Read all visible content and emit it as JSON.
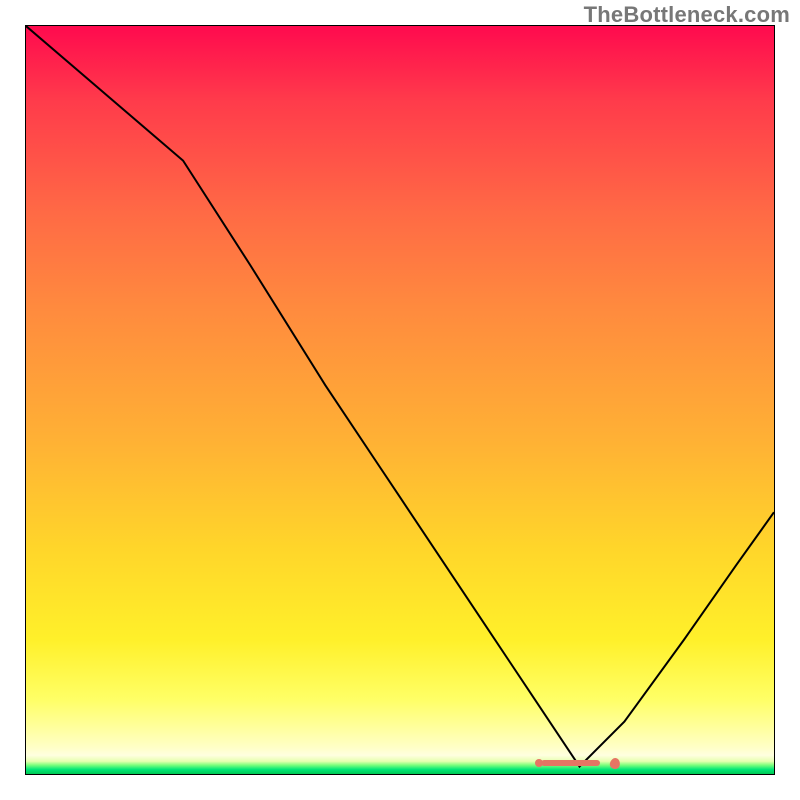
{
  "watermark": "TheBottleneck.com",
  "chart_data": {
    "type": "line",
    "title": "",
    "xlabel": "",
    "ylabel": "",
    "xlim": [
      0,
      1
    ],
    "ylim": [
      0,
      1
    ],
    "notes": "Background is a vertical heat gradient (red at top through orange/yellow to a thin green band at the very bottom). A single black V-shaped curve starts at the top-left, descends with a slight knee around x≈0.21, reaches its minimum near x≈0.74 at the bottom, then rises to the right edge.",
    "series": [
      {
        "name": "bottleneck-curve",
        "x": [
          0.0,
          0.07,
          0.14,
          0.21,
          0.3,
          0.4,
          0.5,
          0.6,
          0.68,
          0.74,
          0.8,
          0.88,
          0.95,
          1.0
        ],
        "y": [
          1.0,
          0.94,
          0.88,
          0.82,
          0.68,
          0.52,
          0.37,
          0.22,
          0.1,
          0.01,
          0.07,
          0.18,
          0.28,
          0.35
        ]
      }
    ],
    "valley_marker": {
      "x_center": 0.74,
      "y": 0.01,
      "color": "#e57564",
      "description": "short salmon bar with a small detached ellipse on the right"
    },
    "gradient_stops": [
      {
        "pos": 0.0,
        "color": "#ff0a4e"
      },
      {
        "pos": 0.25,
        "color": "#ff6a45"
      },
      {
        "pos": 0.55,
        "color": "#ffb035"
      },
      {
        "pos": 0.82,
        "color": "#fff02a"
      },
      {
        "pos": 0.96,
        "color": "#ffffc8"
      },
      {
        "pos": 1.0,
        "color": "#00c853"
      }
    ]
  }
}
